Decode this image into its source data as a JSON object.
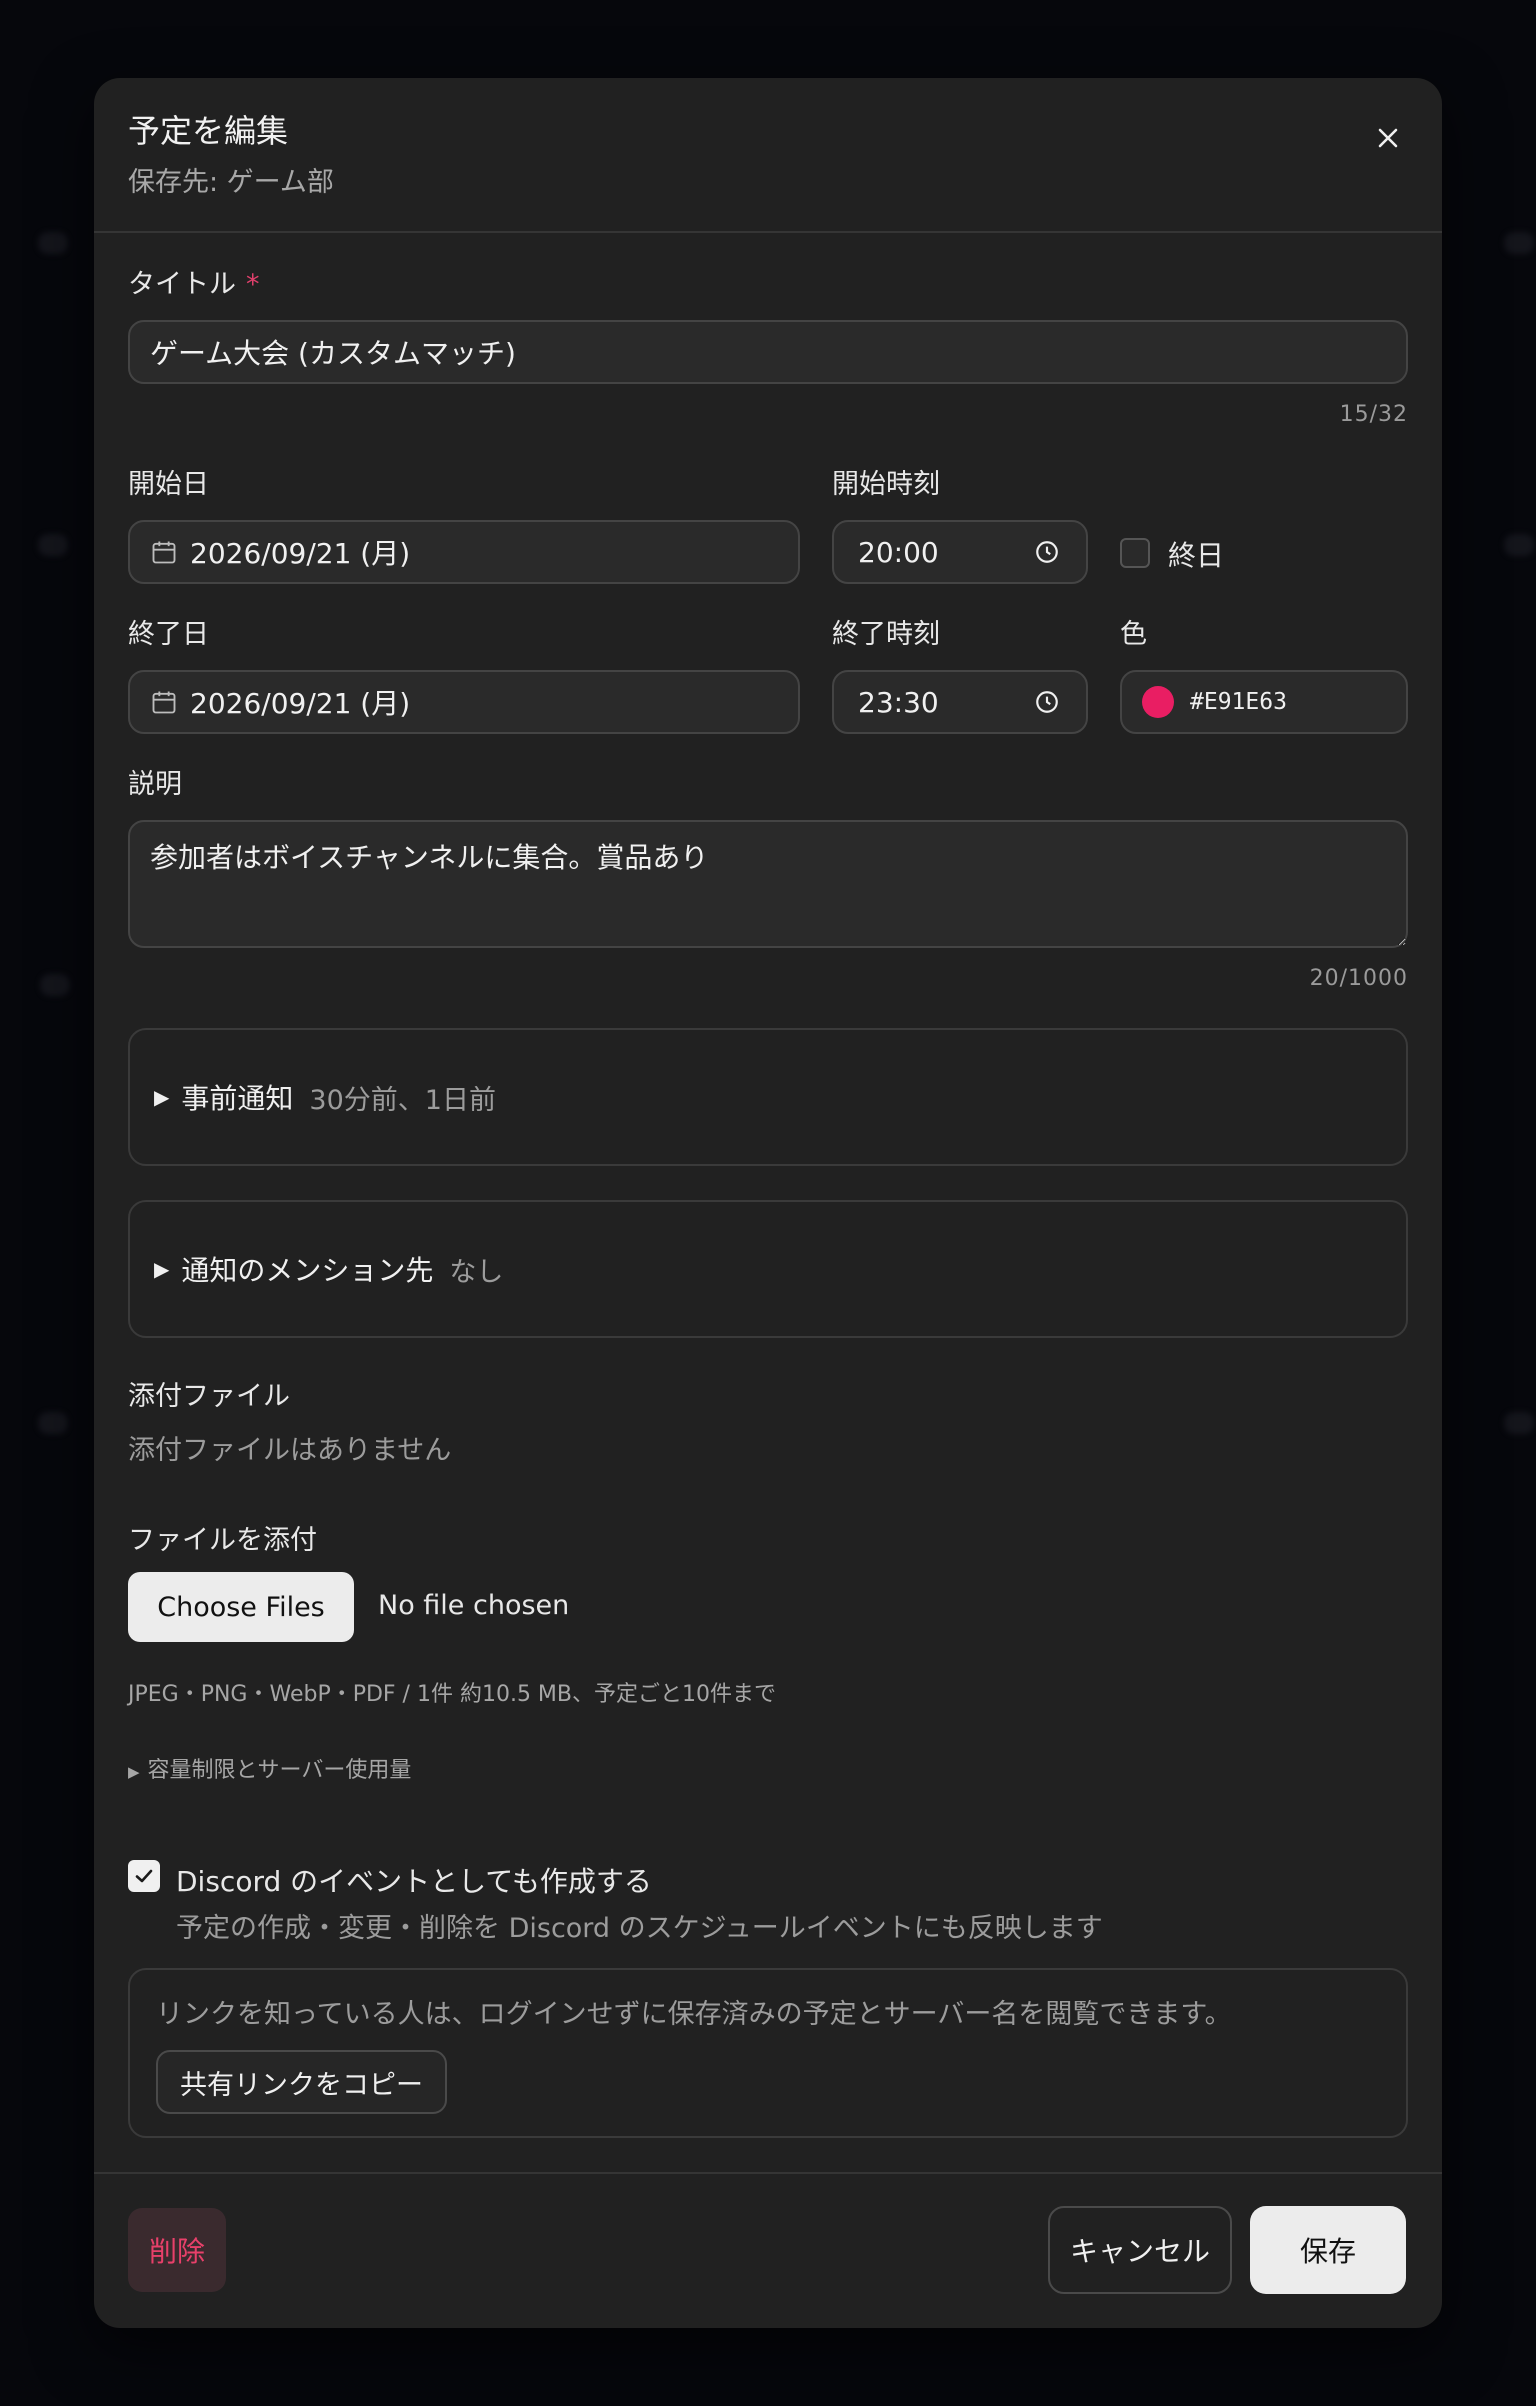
{
  "modal": {
    "title": "予定を編集",
    "subtitle": "保存先: ゲーム部"
  },
  "form": {
    "title_label": "タイトル",
    "title_required_mark": "*",
    "title_value": "ゲーム大会 (カスタムマッチ)",
    "title_counter": "15/32",
    "start_date_label": "開始日",
    "start_date_value": "2026/09/21 (月)",
    "start_time_label": "開始時刻",
    "start_time_value": "20:00",
    "all_day_label": "終日",
    "end_date_label": "終了日",
    "end_date_value": "2026/09/21 (月)",
    "end_time_label": "終了時刻",
    "end_time_value": "23:30",
    "color_label": "色",
    "color_value": "#E91E63",
    "description_label": "説明",
    "description_value": "参加者はボイスチャンネルに集合。賞品あり",
    "description_counter": "20/1000"
  },
  "notifications": {
    "advance_title": "事前通知",
    "advance_value": "30分前、1日前",
    "mention_title": "通知のメンション先",
    "mention_value": "なし"
  },
  "attachments": {
    "heading": "添付ファイル",
    "empty_text": "添付ファイルはありません",
    "attach_label": "ファイルを添付",
    "choose_button": "Choose Files",
    "no_file_text": "No file chosen",
    "limits_text": "JPEG・PNG・WebP・PDF / 1件 約10.5 MB、予定ごと10件まで",
    "quota_toggle": "容量制限とサーバー使用量"
  },
  "discord": {
    "checkbox_label": "Discord のイベントとしても作成する",
    "checkbox_checked": true,
    "help_text": "予定の作成・変更・削除を Discord のスケジュールイベントにも反映します"
  },
  "share": {
    "info_text": "リンクを知っている人は、ログインせずに保存済みの予定とサーバー名を閲覧できます。",
    "copy_button": "共有リンクをコピー"
  },
  "footer": {
    "delete_button": "削除",
    "cancel_button": "キャンセル",
    "save_button": "保存"
  },
  "colors": {
    "accent": "#E91E63",
    "danger": "#e8406a",
    "background": "#06070c",
    "modal": "#212121"
  },
  "icons": [
    "close-icon",
    "calendar-icon",
    "clock-icon",
    "caret-right-icon",
    "check-icon"
  ]
}
